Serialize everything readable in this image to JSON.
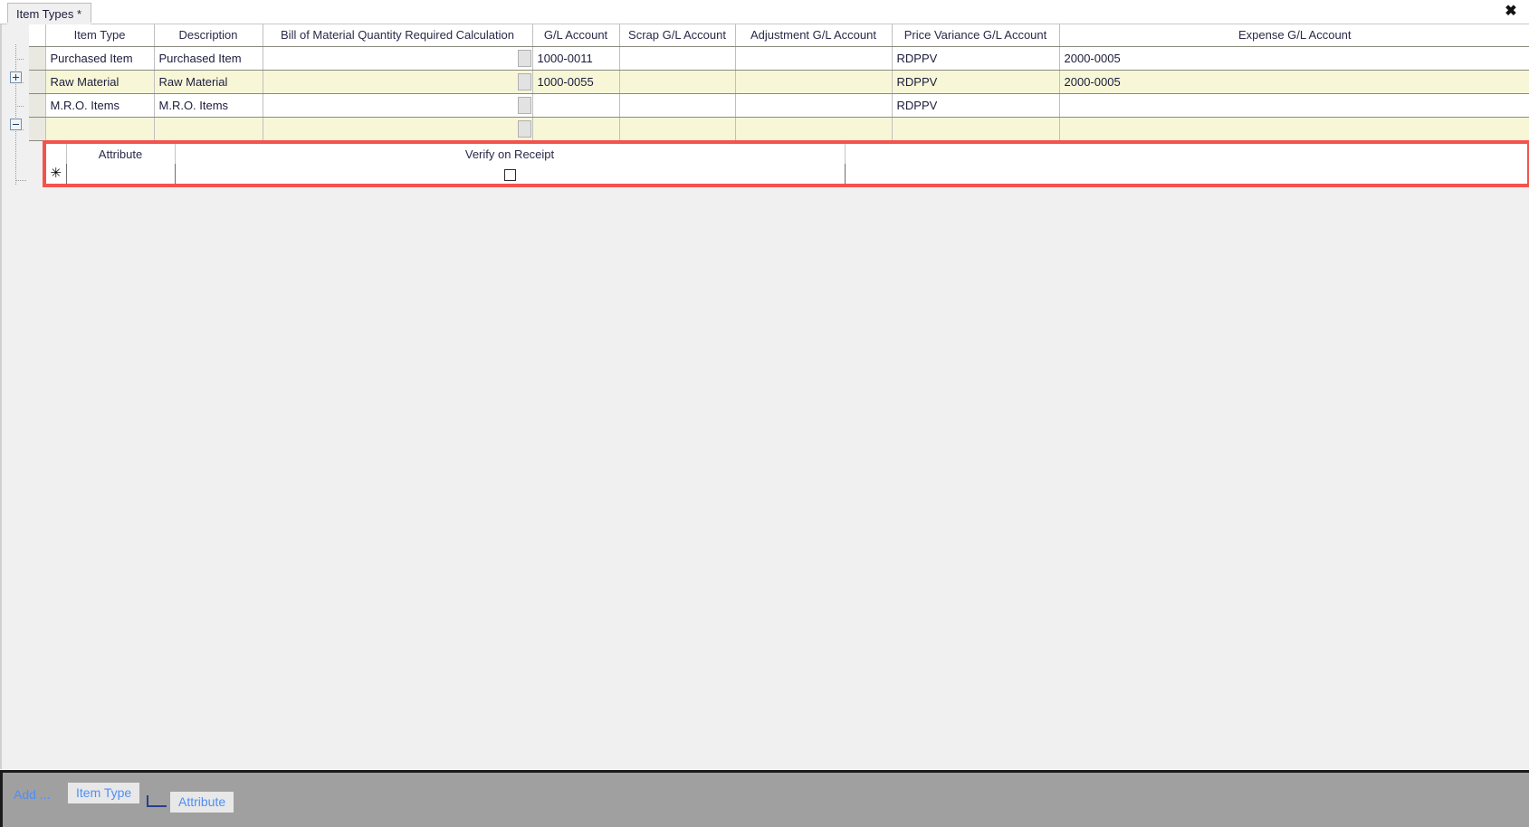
{
  "window": {
    "close_label": "✖"
  },
  "tabs": [
    {
      "label": "Item Types *",
      "name": "tab-item-types",
      "active": true
    }
  ],
  "main_grid": {
    "columns": [
      {
        "key": "rowhdr",
        "label": ""
      },
      {
        "key": "item_type",
        "label": "Item Type"
      },
      {
        "key": "description",
        "label": "Description"
      },
      {
        "key": "bom_qty_calc",
        "label": "Bill of Material Quantity Required Calculation"
      },
      {
        "key": "gl_account",
        "label": "G/L Account"
      },
      {
        "key": "scrap_gl_account",
        "label": "Scrap G/L Account"
      },
      {
        "key": "adjustment_gl_account",
        "label": "Adjustment G/L Account"
      },
      {
        "key": "price_variance_gl_account",
        "label": "Price Variance G/L Account"
      },
      {
        "key": "expense_gl_account",
        "label": "Expense G/L Account"
      }
    ],
    "rows": [
      {
        "item_type": "Purchased Item",
        "description": "Purchased Item",
        "bom_qty_calc": "",
        "gl_account": "1000-0011",
        "scrap_gl_account": "",
        "adjustment_gl_account": "",
        "price_variance_gl_account": "RDPPV",
        "expense_gl_account": "2000-0005",
        "highlight": false,
        "tree": "none"
      },
      {
        "item_type": "Raw Material",
        "description": "Raw Material",
        "bom_qty_calc": "",
        "gl_account": "1000-0055",
        "scrap_gl_account": "",
        "adjustment_gl_account": "",
        "price_variance_gl_account": "RDPPV",
        "expense_gl_account": "2000-0005",
        "highlight": true,
        "tree": "plus"
      },
      {
        "item_type": "M.R.O. Items",
        "description": "M.R.O. Items",
        "bom_qty_calc": "",
        "gl_account": "",
        "scrap_gl_account": "",
        "adjustment_gl_account": "",
        "price_variance_gl_account": "RDPPV",
        "expense_gl_account": "",
        "highlight": false,
        "tree": "none"
      },
      {
        "item_type": "",
        "description": "",
        "bom_qty_calc": "",
        "gl_account": "",
        "scrap_gl_account": "",
        "adjustment_gl_account": "",
        "price_variance_gl_account": "",
        "expense_gl_account": "",
        "highlight": true,
        "tree": "minus"
      }
    ]
  },
  "sub_grid": {
    "highlight_color": "#f4524d",
    "columns": [
      {
        "key": "attribute",
        "label": "Attribute"
      },
      {
        "key": "verify_on_receipt",
        "label": "Verify on Receipt"
      }
    ],
    "rows": [
      {
        "row_indicator": "✳",
        "attribute": "",
        "verify_on_receipt": false
      }
    ]
  },
  "bottom_bar": {
    "add_label": "Add ...",
    "buttons": [
      {
        "label": "Item Type",
        "name": "flow-button-item-type"
      },
      {
        "label": "Attribute",
        "name": "flow-button-attribute"
      }
    ]
  }
}
